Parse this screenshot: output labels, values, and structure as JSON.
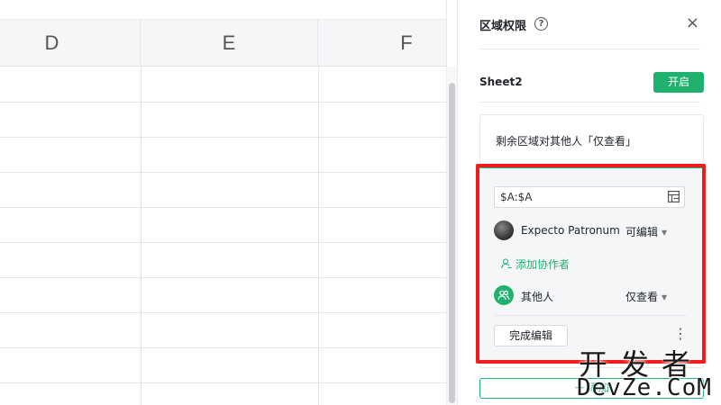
{
  "spreadsheet": {
    "columns": [
      "D",
      "E",
      "F"
    ]
  },
  "panel": {
    "title": "区域权限",
    "help_icon": "?",
    "close_icon": "×",
    "sheet_name": "Sheet2",
    "toggle_label": "开启",
    "rest_label": "剩余区域对其他人「仅查看」",
    "range_value": "$A:$A",
    "collaborators": [
      {
        "name": "Expecto Patronum",
        "permission": "可编辑"
      },
      {
        "name": "其他人",
        "permission": "仅查看"
      }
    ],
    "add_collaborator": "添加协作者",
    "done_button": "完成编辑",
    "more_icon": "⋮",
    "add_area_button": "添加"
  },
  "watermark": {
    "cn": "开发者",
    "en": "DevZe.CoM"
  },
  "colors": {
    "accent_green": "#20b16f",
    "highlight_red": "#ee1c1c"
  }
}
